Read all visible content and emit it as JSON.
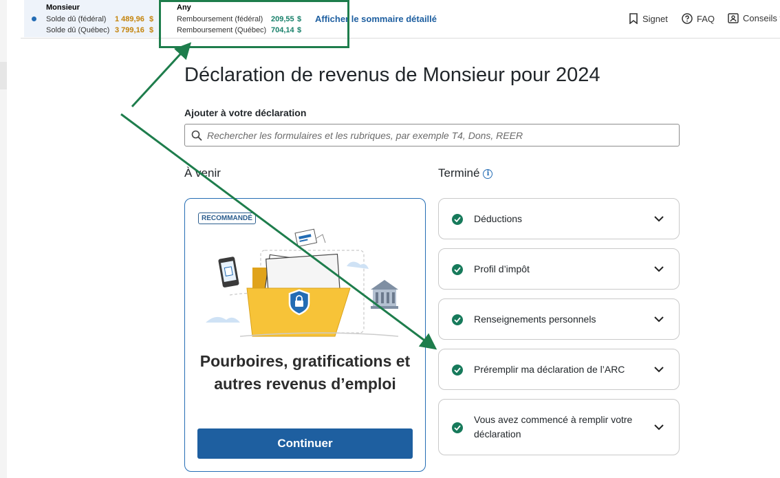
{
  "header": {
    "person1": {
      "name": "Monsieur",
      "rows": [
        {
          "label": "Solde dû (fédéral)",
          "amount": "1 489,96",
          "currency": "$"
        },
        {
          "label": "Solde dû (Québec)",
          "amount": "3 799,16",
          "currency": "$"
        }
      ]
    },
    "person2": {
      "name": "Any",
      "rows": [
        {
          "label": "Remboursement (fédéral)",
          "amount": "209,55",
          "currency": "$"
        },
        {
          "label": "Remboursement (Québec)",
          "amount": "704,14",
          "currency": "$"
        }
      ]
    },
    "summary_link": "Afficher le sommaire détaillé",
    "nav": {
      "bookmark": "Signet",
      "faq": "FAQ",
      "tips": "Conseils f"
    }
  },
  "main": {
    "title": "Déclaration de revenus de Monsieur pour 2024",
    "add_label": "Ajouter à votre déclaration",
    "search_placeholder": "Rechercher les formulaires et les rubriques, par exemple T4, Dons, REER",
    "upcoming_heading": "À venir",
    "done_heading": "Terminé",
    "info_glyph": "i",
    "card": {
      "badge": "RECOMMANDÉ",
      "title": "Pourboires, gratifications et autres revenus d’emploi",
      "button": "Continuer"
    },
    "completed": [
      {
        "label": "Déductions"
      },
      {
        "label": "Profil d’impôt"
      },
      {
        "label": "Renseignements personnels"
      },
      {
        "label": "Préremplir ma déclaration de l’ARC"
      },
      {
        "label": "Vous avez commencé à remplir votre déclaration"
      }
    ]
  },
  "colors": {
    "brand_blue": "#1e5fa0",
    "check_green": "#177a5b",
    "annotation_green": "#1e7d4c",
    "balance_due": "#c4830a",
    "refund": "#17806a"
  },
  "icons": {
    "bookmark": "bookmark-icon",
    "faq": "question-circle-icon",
    "tips": "tips-icon",
    "search": "search-icon",
    "info": "info-icon",
    "check": "check-circle-icon",
    "chevron": "chevron-down-icon"
  }
}
